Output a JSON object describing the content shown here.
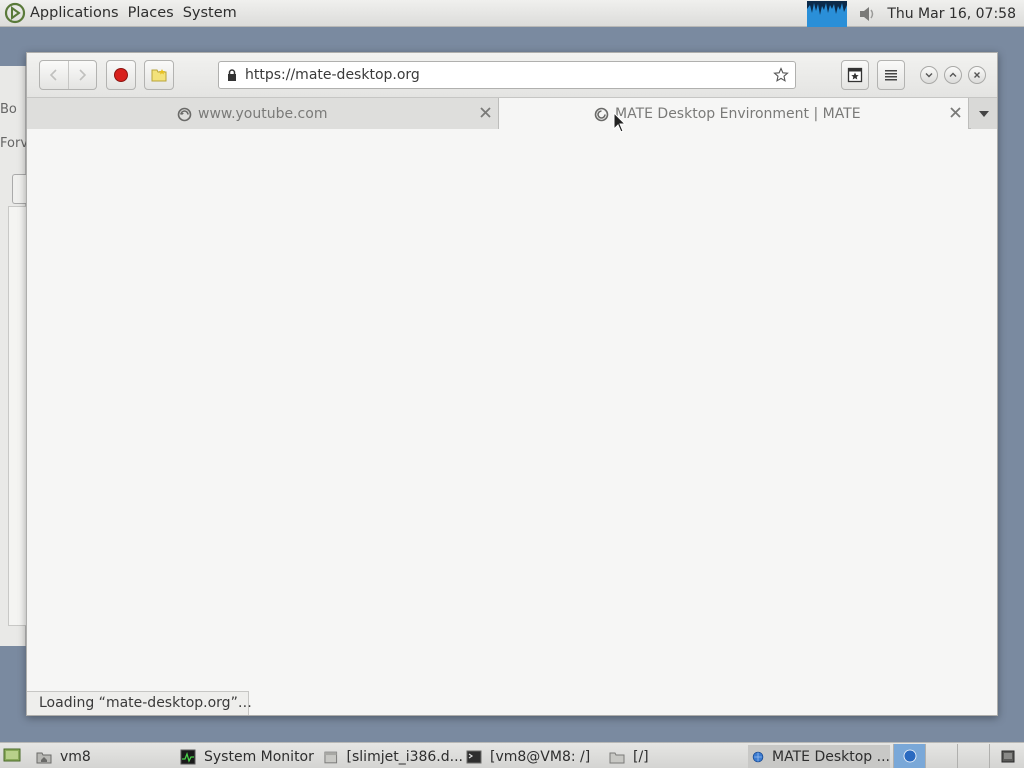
{
  "top_panel": {
    "menus": [
      "Applications",
      "Places",
      "System"
    ],
    "clock": "Thu Mar 16, 07:58"
  },
  "background_window": {
    "fragment1": "Bo",
    "fragment2": "Forv"
  },
  "browser": {
    "url": "https://mate-desktop.org",
    "tabs": [
      {
        "title": "www.youtube.com",
        "active": false
      },
      {
        "title": "MATE Desktop Environment | MATE",
        "active": true
      }
    ],
    "status": "Loading “mate-desktop.org”…",
    "colors": {
      "record": "#d8201c",
      "background": "#f6f6f5"
    }
  },
  "taskbar": {
    "items": [
      {
        "label": "vm8",
        "icon": "home-folder-icon"
      },
      {
        "label": "System Monitor",
        "icon": "system-monitor-icon"
      },
      {
        "label": "[slimjet_i386.d...",
        "icon": "package-icon"
      },
      {
        "label": "[vm8@VM8: /]",
        "icon": "terminal-icon"
      },
      {
        "label": "[/]",
        "icon": "folder-icon"
      },
      {
        "label": "MATE Desktop ...",
        "icon": "browser-icon"
      }
    ]
  }
}
